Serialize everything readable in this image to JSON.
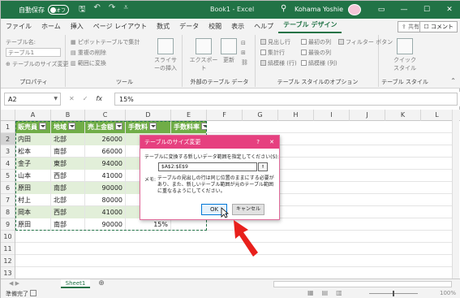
{
  "titlebar": {
    "autosave_label": "自動保存",
    "autosave_state": "オフ",
    "doc_title": "Book1 - Excel",
    "user_name": "Kohama Yoshie",
    "bg_color": "#217346"
  },
  "tabs": [
    "ファイル",
    "ホーム",
    "挿入",
    "ページ レイアウト",
    "数式",
    "データ",
    "校閲",
    "表示",
    "ヘルプ",
    "テーブル デザイン"
  ],
  "share_label": "共有",
  "comment_label": "コメント",
  "ribbon": {
    "props": {
      "name_label": "テーブル名:",
      "name_value": "テーブル1",
      "resize_label": "テーブルのサイズ変更",
      "group_label": "プロパティ"
    },
    "tools": {
      "pivot": "ピボットテーブルで集計",
      "dedupe": "重複の削除",
      "convert": "範囲に変換",
      "slicer": "スライサーの挿入",
      "group_label": "ツール"
    },
    "external": {
      "export": "エクスポート",
      "refresh": "更新",
      "group_label": "外部のテーブル データ"
    },
    "style_options": {
      "header_row": "見出し行",
      "total_row": "集計行",
      "banded_rows": "縞模様 (行)",
      "first_col": "最初の列",
      "last_col": "最後の列",
      "banded_cols": "縞模様 (列)",
      "filter_btn": "フィルター ボタン",
      "group_label": "テーブル スタイルのオプション"
    },
    "styles": {
      "quick": "クイック スタイル",
      "group_label": "テーブル スタイル"
    }
  },
  "formula_bar": {
    "name_box": "A2",
    "formula": "15%"
  },
  "grid": {
    "columns": [
      "A",
      "B",
      "C",
      "D",
      "E",
      "F",
      "G",
      "H",
      "I",
      "J",
      "K",
      "L"
    ],
    "row_numbers": [
      "1",
      "2",
      "3",
      "4",
      "5",
      "6",
      "7",
      "8",
      "9",
      "10",
      "11",
      "12",
      "13"
    ],
    "headers": [
      "販売員",
      "地域",
      "売上金額",
      "手数料",
      "手数料率"
    ],
    "rows": [
      [
        "内田",
        "北部",
        "26000",
        "",
        ""
      ],
      [
        "松本",
        "南部",
        "66000",
        "",
        ""
      ],
      [
        "金子",
        "東部",
        "94000",
        "",
        ""
      ],
      [
        "山本",
        "西部",
        "41000",
        "",
        ""
      ],
      [
        "原田",
        "南部",
        "90000",
        "",
        ""
      ],
      [
        "村上",
        "北部",
        "80000",
        "",
        ""
      ],
      [
        "岡本",
        "西部",
        "41000",
        "",
        ""
      ],
      [
        "原田",
        "南部",
        "90000",
        "15%",
        ""
      ]
    ],
    "header_color": "#70ad47",
    "band_color": "#e2efd9"
  },
  "dialog": {
    "title": "テーブルのサイズ変更",
    "help": "?",
    "close": "✕",
    "prompt": "テーブルに変換する新しいデータ範囲を指定してください(S):",
    "range": "$A$2:$E$9",
    "note_label": "メモ:",
    "note": "テーブルの見出しの行は同じ位置のままにする必要があり、また、新しいテーブル範囲が元のテーブル範囲に重なるようにしてください。",
    "ok": "OK",
    "cancel": "キャンセル",
    "accent": "#e6407f"
  },
  "sheets": {
    "active": "Sheet1",
    "add": "⊕"
  },
  "status": {
    "ready": "準備完了",
    "zoom": "100%"
  }
}
